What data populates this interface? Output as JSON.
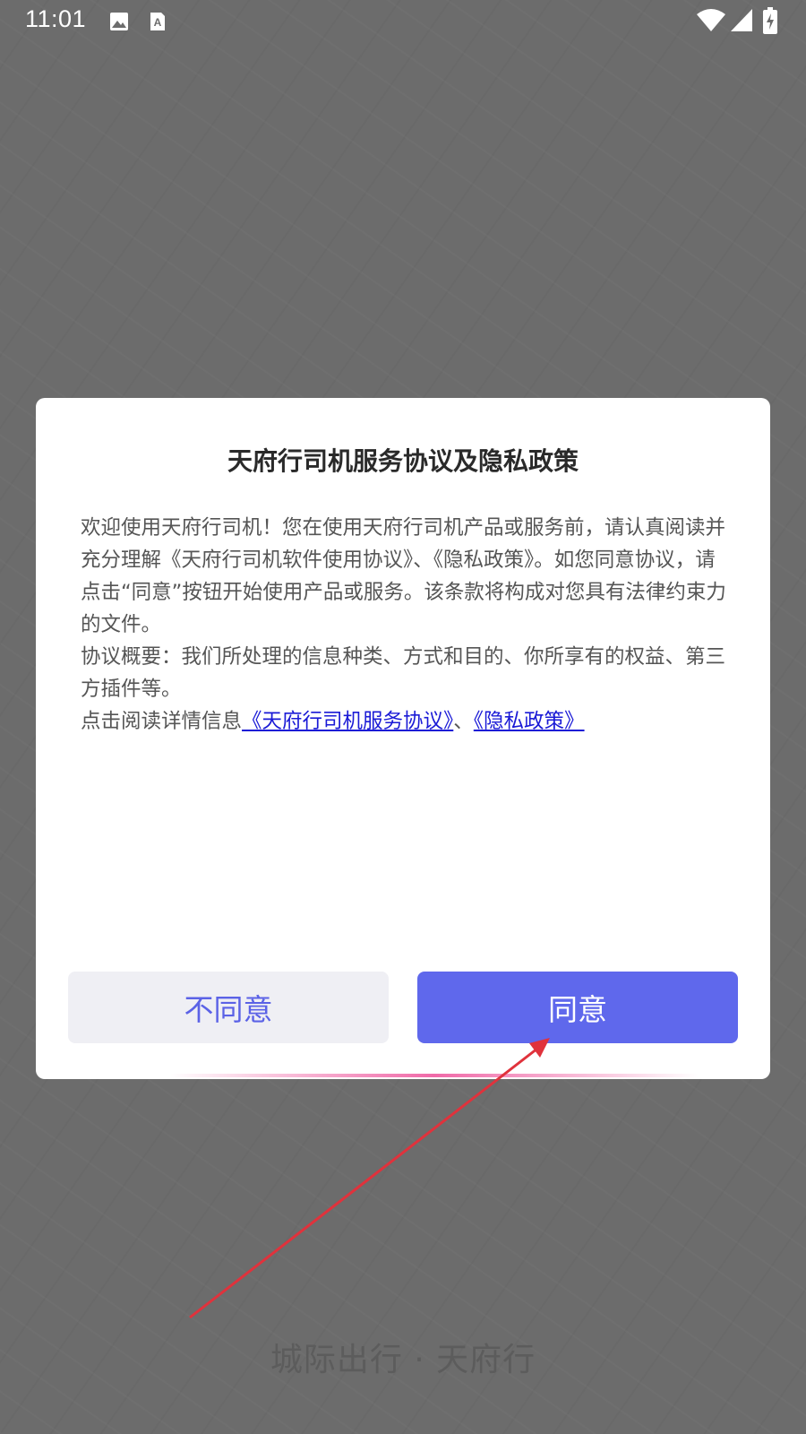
{
  "status_bar": {
    "time": "11:01",
    "icons": [
      "image-icon",
      "font-icon",
      "wifi-icon",
      "signal-icon",
      "battery-charging-icon"
    ]
  },
  "dialog": {
    "title": "天府行司机服务协议及隐私政策",
    "body": {
      "paragraph1": "欢迎使用天府行司机！您在使用天府行司机产品或服务前，请认真阅读并充分理解《天府行司机软件使用协议》、《隐私政策》。如您同意协议，请点击“同意”按钮开始使用产品或服务。该条款将构成对您具有法律约束力的文件。",
      "paragraph2": "协议概要：我们所处理的信息种类、方式和目的、你所享有的权益、第三方插件等。",
      "paragraph3_prefix": "点击阅读详情信息",
      "link_service_agreement": "《天府行司机服务协议》",
      "separator": "、",
      "link_privacy_policy": "《隐私政策》"
    },
    "buttons": {
      "disagree": "不同意",
      "agree": "同意"
    }
  },
  "slogan": "城际出行 · 天府行",
  "colors": {
    "accent": "#5f68ec",
    "link": "#1a1ad6",
    "annotation_arrow": "#e0323c",
    "glow": "#f06aa8"
  }
}
